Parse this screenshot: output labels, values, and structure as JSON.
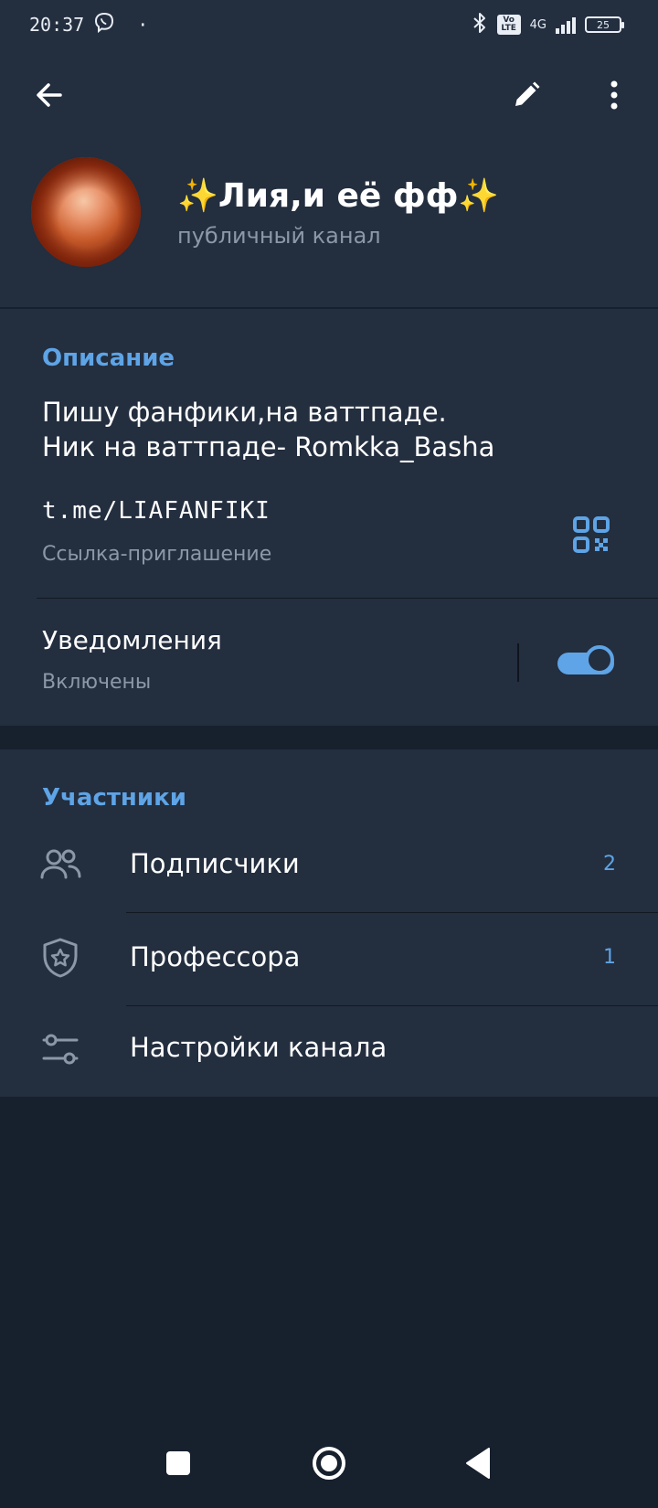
{
  "status_bar": {
    "time": "20:37",
    "dot": "·",
    "volte": "Vo LTE",
    "network": "4G",
    "battery": "25"
  },
  "header": {
    "title": "✨Лия,и её фф✨",
    "subtitle": "публичный канал"
  },
  "info": {
    "section_title": "Описание",
    "description_line1": "Пишу фанфики,на ваттпаде.",
    "description_line2": "Ник на ваттпаде- Romkka_Basha",
    "link": "t.me/LIAFANFIKI",
    "link_caption": "Ссылка-приглашение"
  },
  "notifications": {
    "title": "Уведомления",
    "status": "Включены",
    "enabled": true
  },
  "members": {
    "section_title": "Участники",
    "rows": [
      {
        "label": "Подписчики",
        "count": "2",
        "icon": "people-icon"
      },
      {
        "label": "Профессора",
        "count": "1",
        "icon": "shield-star-icon"
      },
      {
        "label": "Настройки канала",
        "count": "",
        "icon": "sliders-icon"
      }
    ]
  },
  "colors": {
    "accent": "#5ea4e6",
    "card_bg": "#232e3f",
    "page_bg": "#17202d",
    "secondary_text": "#8c98a8"
  }
}
